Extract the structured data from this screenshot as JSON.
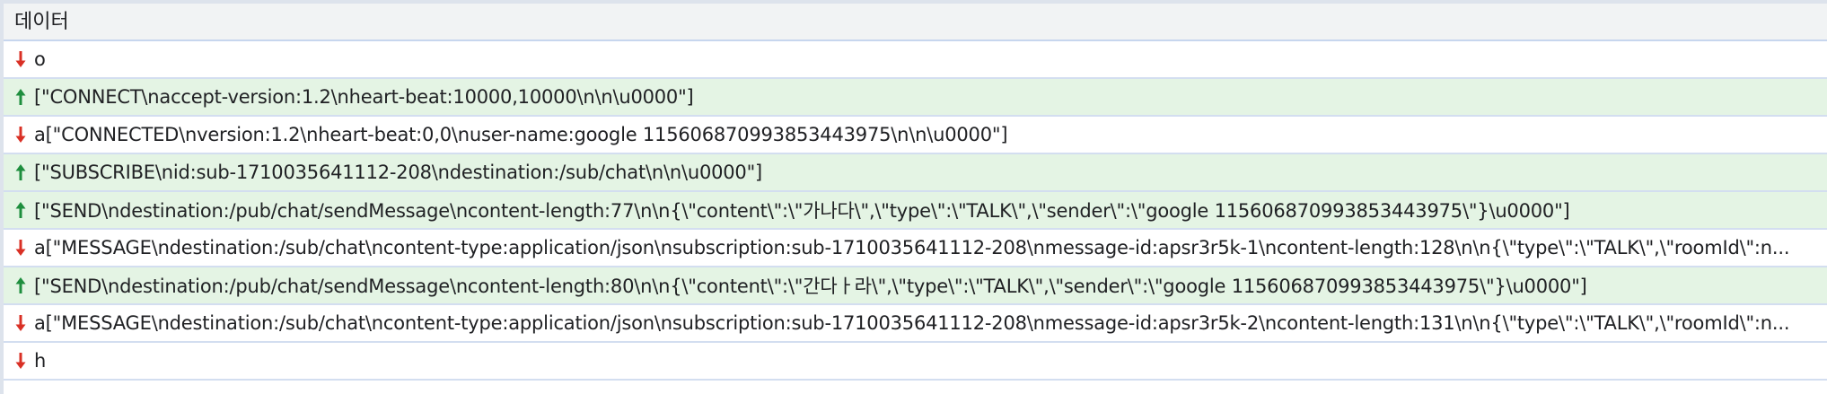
{
  "header": {
    "title": "데이터"
  },
  "colors": {
    "sent_arrow": "#1e8e3e",
    "recv_arrow": "#d93025",
    "sent_bg": "#e4f4e4",
    "recv_bg": "#ffffff",
    "header_bg": "#f1f3f4"
  },
  "messages": [
    {
      "direction": "received",
      "icon": "arrow-down-icon",
      "text": "o"
    },
    {
      "direction": "sent",
      "icon": "arrow-up-icon",
      "text": "[\"CONNECT\\naccept-version:1.2\\nheart-beat:10000,10000\\n\\n\\u0000\"]"
    },
    {
      "direction": "received",
      "icon": "arrow-down-icon",
      "text": "a[\"CONNECTED\\nversion:1.2\\nheart-beat:0,0\\nuser-name:google 115606870993853443975\\n\\n\\u0000\"]"
    },
    {
      "direction": "sent",
      "icon": "arrow-up-icon",
      "text": "[\"SUBSCRIBE\\nid:sub-1710035641112-208\\ndestination:/sub/chat\\n\\n\\u0000\"]"
    },
    {
      "direction": "sent",
      "icon": "arrow-up-icon",
      "text": "[\"SEND\\ndestination:/pub/chat/sendMessage\\ncontent-length:77\\n\\n{\\\"content\\\":\\\"가나다\\\",\\\"type\\\":\\\"TALK\\\",\\\"sender\\\":\\\"google 115606870993853443975\\\"}\\u0000\"]"
    },
    {
      "direction": "received",
      "icon": "arrow-down-icon",
      "text": "a[\"MESSAGE\\ndestination:/sub/chat\\ncontent-type:application/json\\nsubscription:sub-1710035641112-208\\nmessage-id:apsr3r5k-1\\ncontent-length:128\\n\\n{\\\"type\\\":\\\"TALK\\\",\\\"roomId\\\":n..."
    },
    {
      "direction": "sent",
      "icon": "arrow-up-icon",
      "text": "[\"SEND\\ndestination:/pub/chat/sendMessage\\ncontent-length:80\\n\\n{\\\"content\\\":\\\"간다ㅏ라\\\",\\\"type\\\":\\\"TALK\\\",\\\"sender\\\":\\\"google 115606870993853443975\\\"}\\u0000\"]"
    },
    {
      "direction": "received",
      "icon": "arrow-down-icon",
      "text": "a[\"MESSAGE\\ndestination:/sub/chat\\ncontent-type:application/json\\nsubscription:sub-1710035641112-208\\nmessage-id:apsr3r5k-2\\ncontent-length:131\\n\\n{\\\"type\\\":\\\"TALK\\\",\\\"roomId\\\":n..."
    },
    {
      "direction": "received",
      "icon": "arrow-down-icon",
      "text": "h"
    }
  ]
}
